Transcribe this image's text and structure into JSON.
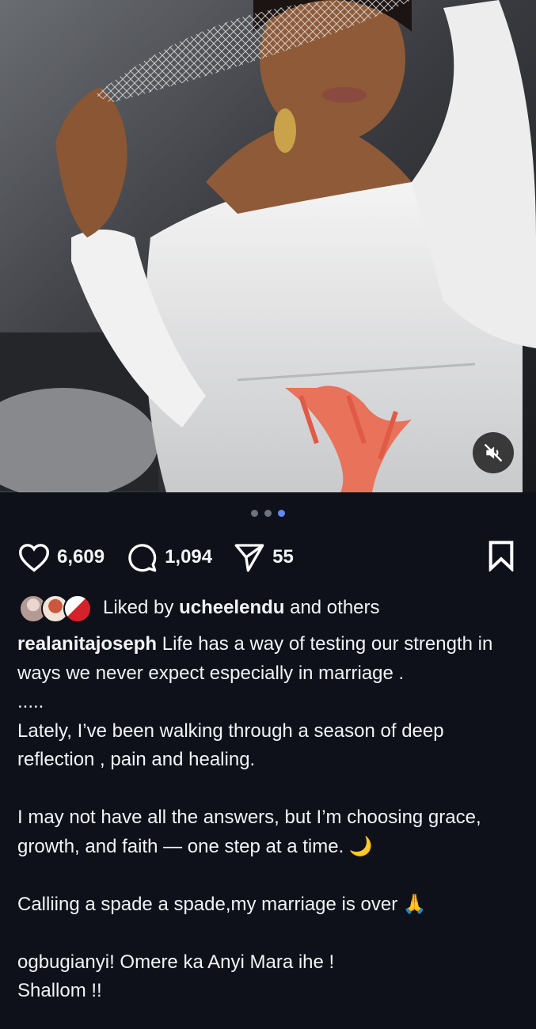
{
  "media": {
    "carousel": {
      "count": 3,
      "active_index": 2
    },
    "mute_icon": "speaker-muted-icon"
  },
  "actions": {
    "likes": "6,609",
    "comments": "1,094",
    "shares": "55",
    "icons": {
      "like": "heart-icon",
      "comment": "comment-bubble-icon",
      "share": "paper-plane-icon",
      "save": "bookmark-icon"
    }
  },
  "liked_by": {
    "prefix": "Liked by",
    "user": "ucheelendu",
    "suffix": "and others"
  },
  "caption": {
    "username": "realanitajoseph",
    "line1": " Life has a way of testing our strength in ways we never expect especially in marriage .",
    "dots": ".....",
    "para2": "Lately, I’ve been walking through a season of deep reflection , pain and healing.",
    "para3": "I may not have all the answers, but I’m choosing grace, growth, and faith — one step at a time. 🌙",
    "para4": "Calliing a spade a  spade,my marriage is over 🙏",
    "para5": " ogbugianyi! Omere ka Anyi Mara ihe !",
    "para6": "Shallom !!"
  },
  "colors": {
    "background": "#0e1119",
    "text": "#f2f4f7",
    "dot_active": "#5b8cff",
    "dot_inactive": "#6b7280"
  }
}
